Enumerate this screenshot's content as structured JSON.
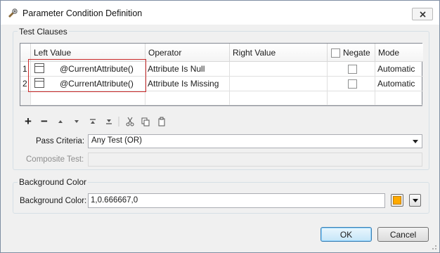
{
  "window": {
    "title": "Parameter Condition Definition"
  },
  "test_clauses": {
    "group_title": "Test Clauses",
    "columns": {
      "left_value": "Left Value",
      "operator": "Operator",
      "right_value": "Right Value",
      "negate": "Negate",
      "mode": "Mode"
    },
    "negate_header_checked": false,
    "rows": [
      {
        "num": "1",
        "left_value": "@CurrentAttribute()",
        "operator": "Attribute Is Null",
        "right_value": "",
        "negate": false,
        "mode": "Automatic"
      },
      {
        "num": "2",
        "left_value": "@CurrentAttribute()",
        "operator": "Attribute Is Missing",
        "right_value": "",
        "negate": false,
        "mode": "Automatic"
      }
    ]
  },
  "toolbar": {
    "icons": [
      "add-icon",
      "remove-icon",
      "move-up-icon",
      "move-down-icon",
      "move-top-icon",
      "move-bottom-icon",
      "cut-icon",
      "copy-icon",
      "paste-icon"
    ]
  },
  "pass_criteria": {
    "label": "Pass Criteria:",
    "value": "Any Test (OR)"
  },
  "composite_test": {
    "label": "Composite Test:",
    "value": ""
  },
  "background_color": {
    "group_title": "Background Color",
    "label": "Background Color:",
    "value": "1,0.666667,0",
    "swatch_color": "#ffaa00"
  },
  "buttons": {
    "ok": "OK",
    "cancel": "Cancel"
  }
}
